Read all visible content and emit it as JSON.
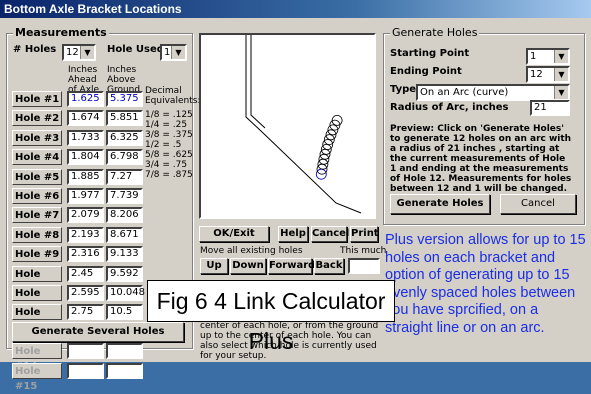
{
  "window": {
    "title": "Bottom Axle Bracket Locations"
  },
  "measurements": {
    "group_label": "Measurements",
    "num_holes_label": "# Holes",
    "num_holes_value": "12",
    "hole_used_label": "Hole Used",
    "hole_used_value": "1",
    "col_ahead": "Inches Ahead of Axle",
    "col_above": "Inches Above Ground",
    "decimal_label": "Decimal Equivalents:",
    "equivalents": [
      "1/8 = .125",
      "1/4 = .25",
      "3/8 = .375",
      "1/2 = .5",
      "5/8 = .625",
      "3/4 = .75",
      "7/8 = .875"
    ],
    "holes": [
      {
        "label": "Hole #1",
        "ahead": "1.625",
        "above": "5.375"
      },
      {
        "label": "Hole #2",
        "ahead": "1.674",
        "above": "5.851"
      },
      {
        "label": "Hole #3",
        "ahead": "1.733",
        "above": "6.325"
      },
      {
        "label": "Hole #4",
        "ahead": "1.804",
        "above": "6.798"
      },
      {
        "label": "Hole #5",
        "ahead": "1.885",
        "above": "7.27"
      },
      {
        "label": "Hole #6",
        "ahead": "1.977",
        "above": "7.739"
      },
      {
        "label": "Hole #7",
        "ahead": "2.079",
        "above": "8.206"
      },
      {
        "label": "Hole #8",
        "ahead": "2.193",
        "above": "8.671"
      },
      {
        "label": "Hole #9",
        "ahead": "2.316",
        "above": "9.133"
      },
      {
        "label": "Hole #10",
        "ahead": "2.45",
        "above": "9.592"
      },
      {
        "label": "Hole #11",
        "ahead": "2.595",
        "above": "10.048"
      },
      {
        "label": "Hole #12",
        "ahead": "2.75",
        "above": "10.5"
      },
      {
        "label": "Hole #13",
        "ahead": "",
        "above": ""
      },
      {
        "label": "Hole #14",
        "ahead": "",
        "above": ""
      },
      {
        "label": "Hole #15",
        "ahead": "",
        "above": ""
      }
    ],
    "generate_several_label": "Generate Several Holes"
  },
  "middle": {
    "ok_exit": "OK/Exit",
    "help": "Help",
    "cancel": "Cancel",
    "print": "Print",
    "move_all_label": "Move all existing holes",
    "this_much_label": "This much",
    "up": "Up",
    "down": "Down",
    "forward": "Forward",
    "back": "Back",
    "desc": "center of each hole, or from the ground up to the center of each hole. You can also select which hole is currently used for your setup."
  },
  "generate": {
    "group_label": "Generate Holes",
    "starting_point_label": "Starting Point",
    "starting_point_value": "1",
    "ending_point_label": "Ending Point",
    "ending_point_value": "12",
    "type_label": "Type",
    "type_value": "On an Arc (curve)",
    "radius_label": "Radius of Arc, inches",
    "radius_value": "21",
    "preview_text": "Preview:  Click on 'Generate Holes' to generate 12 holes on an arc with a radius of 21 inches , starting at the current measurements of Hole 1 and ending at the measurements of Hole 12.  Measurements for holes between  12 and  1 will be changed.",
    "generate_button": "Generate Holes",
    "cancel_button": "Cancel"
  },
  "overlay": {
    "plus_text": "Plus version allows for up to 15 holes on each bracket and option of generating up to 15 evenly spaced holes between you have sprcified, on a straight line or on an arc.",
    "fig_caption": "Fig 6  4 Link Calculator Plus"
  },
  "colors": {
    "accent_text": "#1a2ee6",
    "hole_blue_text": "#0000cc"
  }
}
